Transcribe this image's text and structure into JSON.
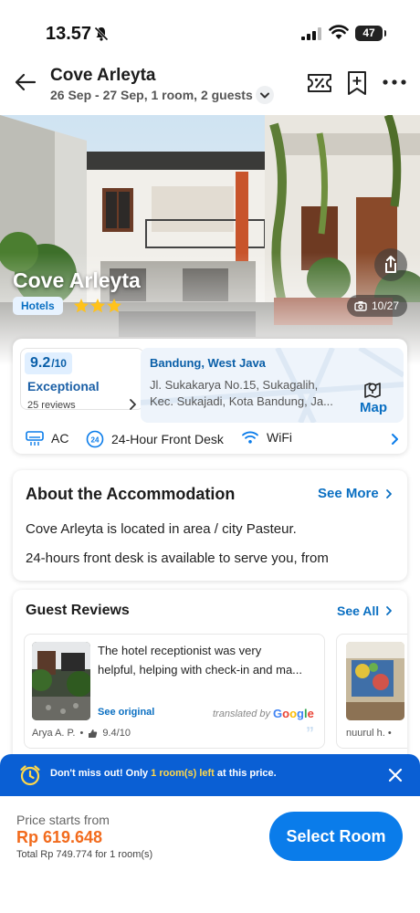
{
  "status_bar": {
    "time": "13.57",
    "battery": "47"
  },
  "header": {
    "title": "Cove Arleyta",
    "subtitle": "26 Sep - 27 Sep, 1 room, 2 guests"
  },
  "hero": {
    "hotel_name": "Cove Arleyta",
    "category": "Hotels",
    "stars": 3,
    "photo_counter": "10/27"
  },
  "info": {
    "score": "9.2",
    "score_max": "/10",
    "rating_label": "Exceptional",
    "reviews": "25 reviews",
    "city": "Bandung, West Java",
    "address_line1": "Jl. Sukakarya No.15, Sukagalih,",
    "address_line2": "Kec. Sukajadi, Kota Bandung, Ja...",
    "map_label": "Map",
    "amenities": [
      "AC",
      "24-Hour Front Desk",
      "WiFi"
    ]
  },
  "about": {
    "title": "About the Accommodation",
    "see_more": "See More",
    "line1": "Cove Arleyta is located in area / city Pasteur.",
    "line2": "24-hours front desk is available to serve you, from"
  },
  "reviews": {
    "title": "Guest Reviews",
    "see_all": "See All",
    "items": [
      {
        "text_line1": "The hotel receptionist was very",
        "text_line2": "helpful, helping with check-in and ma...",
        "see_original": "See original",
        "translated_by": "translated by",
        "translator": "Google",
        "reviewer": "Arya A. P.",
        "score": "9.4/10"
      },
      {
        "reviewer": "nuurul h."
      }
    ]
  },
  "banner": {
    "text_before": "Don't miss out! Only ",
    "highlight": "1 room(s) left",
    "text_after": " at this price."
  },
  "bottom": {
    "price_label": "Price starts from",
    "price": "Rp 619.648",
    "total": "Total Rp 749.774 for 1 room(s)",
    "cta": "Select Room"
  },
  "colors": {
    "brand_blue": "#0a7cea",
    "price_orange": "#f26b1d",
    "banner_blue": "#0a5fd4",
    "banner_highlight": "#ffd84a"
  }
}
